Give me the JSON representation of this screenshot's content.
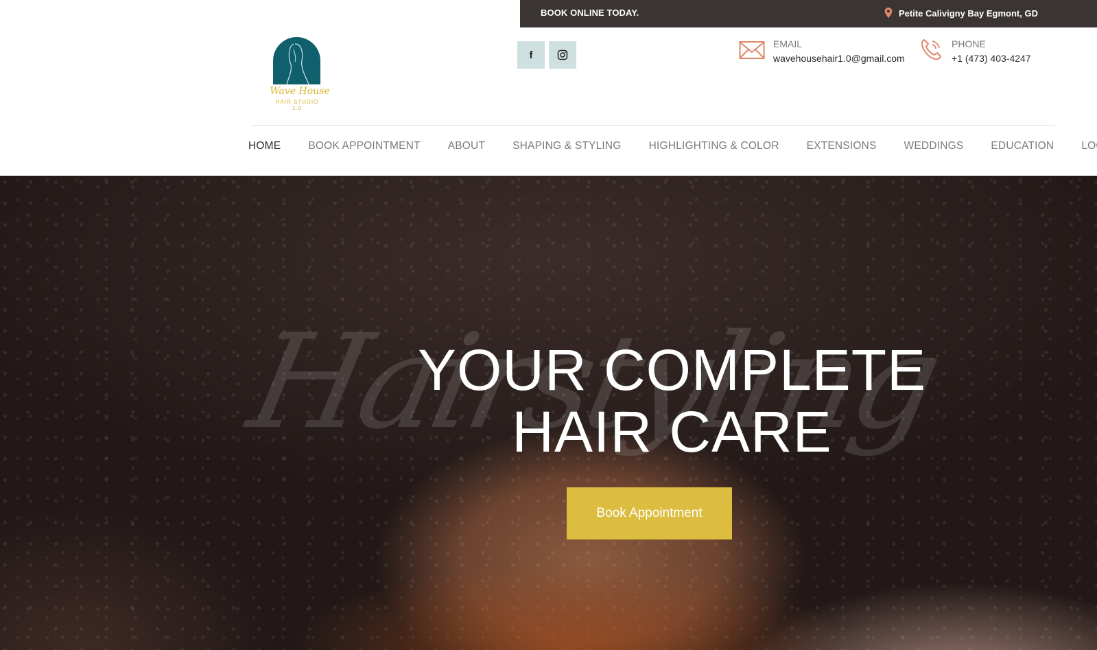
{
  "topbar": {
    "book_online": "BOOK ONLINE TODAY.",
    "location": "Petite Calivigny Bay Egmont, GD",
    "location_icon": "map-pin-icon"
  },
  "logo": {
    "script_text": "Wave House",
    "sub_text": "HAIR STUDIO",
    "sub_text_2": "1.0"
  },
  "social": [
    {
      "name": "facebook-icon",
      "glyph": "f"
    },
    {
      "name": "instagram-icon",
      "glyph": "◎"
    }
  ],
  "contact": {
    "email_label": "EMAIL",
    "email_value": "wavehousehair1.0@gmail.com",
    "email_icon": "envelope-icon",
    "phone_label": "PHONE",
    "phone_value": "+1 (473) 403-4247",
    "phone_icon": "phone-icon"
  },
  "nav": {
    "items": [
      "HOME",
      "BOOK APPOINTMENT",
      "ABOUT",
      "SHAPING & STYLING",
      "HIGHLIGHTING & COLOR",
      "EXTENSIONS",
      "WEDDINGS",
      "EDUCATION",
      "LOCATION"
    ],
    "active": "HOME"
  },
  "hero": {
    "watermark": "Hairstyling",
    "title_line1": "YOUR COMPLETE",
    "title_line2": "HAIR CARE",
    "cta_label": "Book Appointment"
  },
  "colors": {
    "topbar_bg": "#3a3533",
    "accent_gold": "#dcbd3f",
    "logo_teal": "#0f5f6d",
    "icon_coral": "#e0876a",
    "social_bg": "#cfe0e0"
  }
}
